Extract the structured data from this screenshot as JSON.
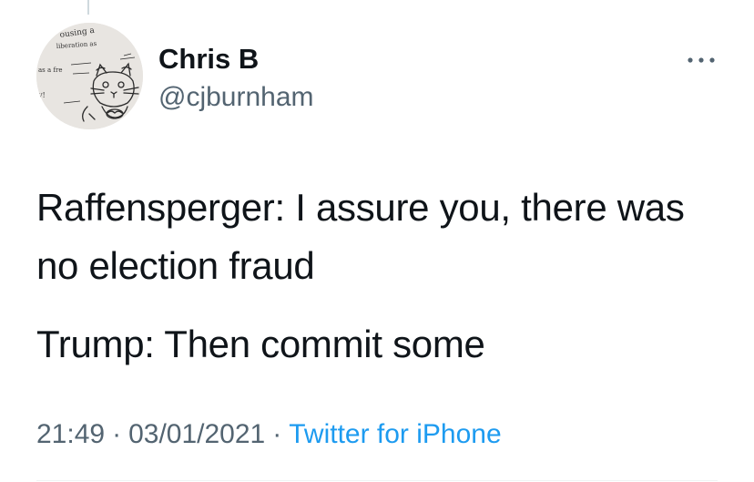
{
  "tweet": {
    "author": {
      "display_name": "Chris B",
      "handle": "@cjburnham",
      "avatar_icon": "hand-drawn-cat-avatar",
      "avatar_scribbles": [
        "ousing a",
        "liberation as",
        "as a fre",
        "y!"
      ]
    },
    "paragraphs": [
      "Raffensperger: I assure you, there was no election fraud",
      "Trump: Then commit some"
    ],
    "time": "21:49",
    "date": "03/01/2021",
    "separator": "·",
    "source": "Twitter for iPhone",
    "more_icon": "more-horizontal-icon"
  },
  "colors": {
    "text_primary": "#0f1419",
    "text_secondary": "#536471",
    "link": "#1d9bf0",
    "divider": "#eff3f4"
  }
}
